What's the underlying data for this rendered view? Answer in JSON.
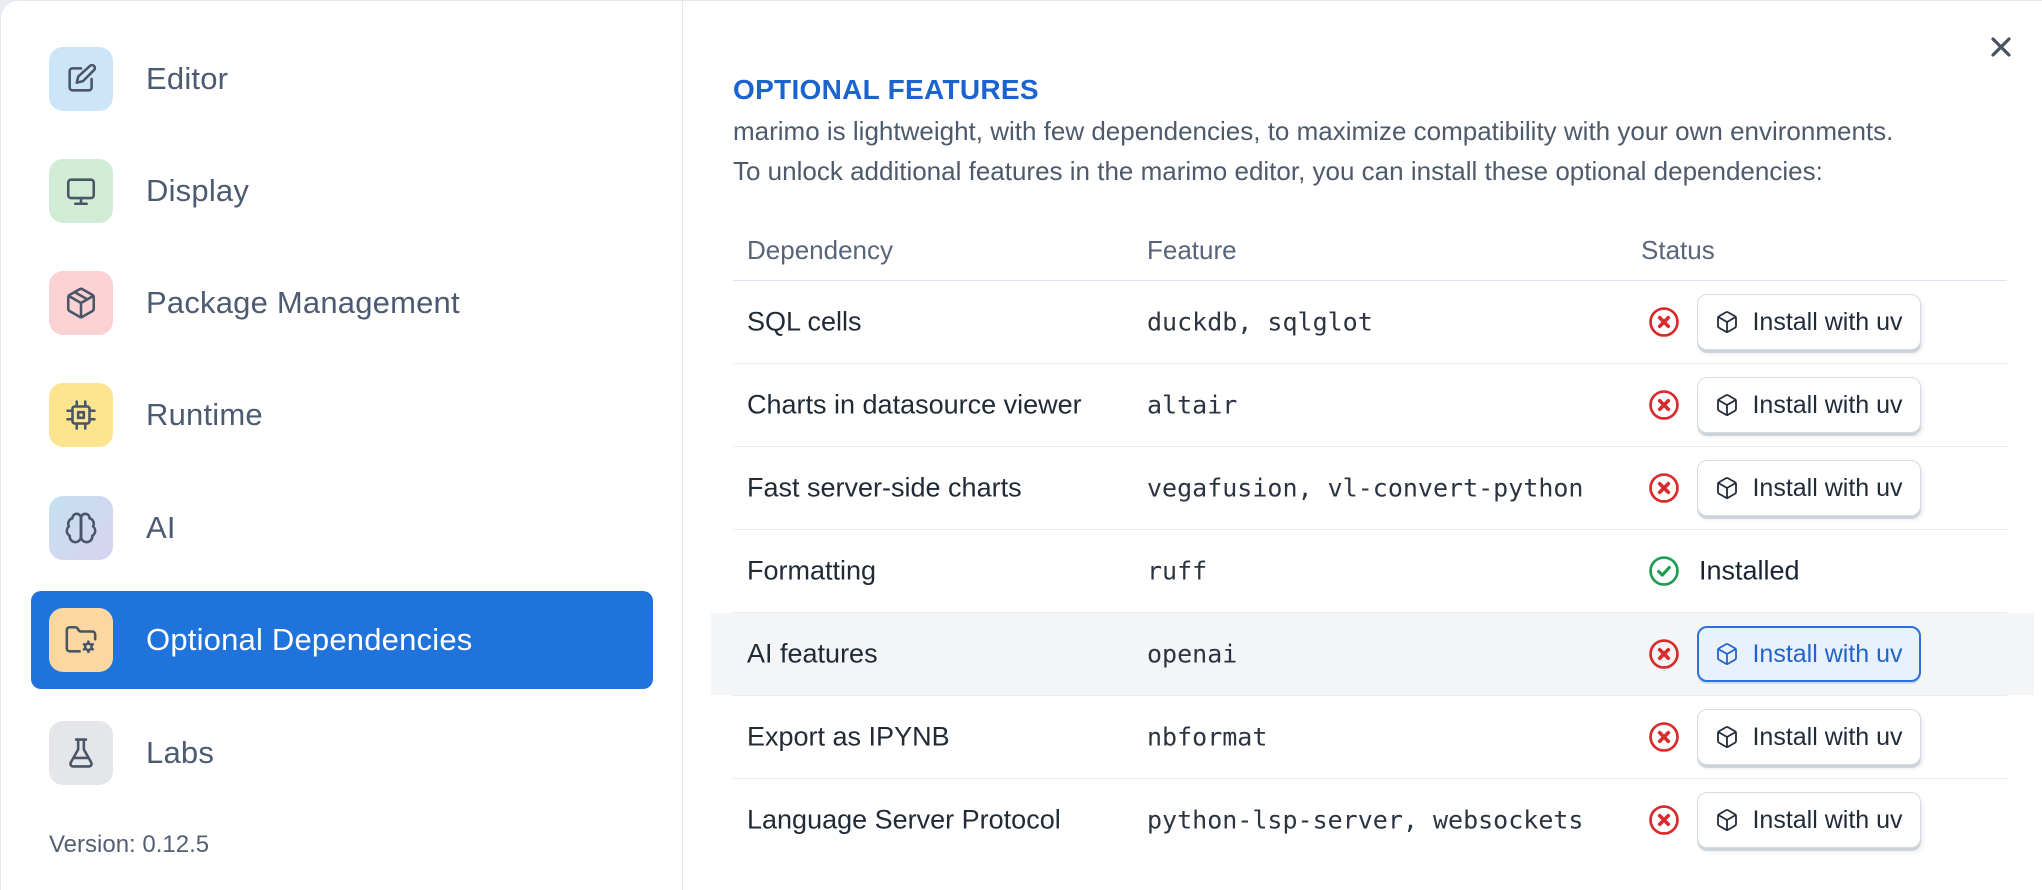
{
  "sidebar": {
    "items": [
      {
        "label": "Editor",
        "icon": "pencil-square-icon"
      },
      {
        "label": "Display",
        "icon": "monitor-icon"
      },
      {
        "label": "Package Management",
        "icon": "package-icon"
      },
      {
        "label": "Runtime",
        "icon": "cpu-icon"
      },
      {
        "label": "AI",
        "icon": "brain-icon"
      },
      {
        "label": "Optional Dependencies",
        "icon": "folder-cog-icon",
        "selected": true
      },
      {
        "label": "Labs",
        "icon": "flask-icon"
      }
    ],
    "version_label": "Version: 0.12.5"
  },
  "panel": {
    "title": "OPTIONAL FEATURES",
    "description_line1": "marimo is lightweight, with few dependencies, to maximize compatibility with your own environments.",
    "description_line2": "To unlock additional features in the marimo editor, you can install these optional dependencies:",
    "close_icon": "close-icon"
  },
  "table": {
    "columns": [
      "Dependency",
      "Feature",
      "Status"
    ],
    "rows": [
      {
        "dependency": "SQL cells",
        "feature": "duckdb, sqlglot",
        "status": "missing",
        "action": "Install with uv"
      },
      {
        "dependency": "Charts in datasource viewer",
        "feature": "altair",
        "status": "missing",
        "action": "Install with uv"
      },
      {
        "dependency": "Fast server-side charts",
        "feature": "vegafusion, vl-convert-python",
        "status": "missing",
        "action": "Install with uv"
      },
      {
        "dependency": "Formatting",
        "feature": "ruff",
        "status": "installed",
        "status_label": "Installed"
      },
      {
        "dependency": "AI features",
        "feature": "openai",
        "status": "missing",
        "action": "Install with uv",
        "highlighted": true
      },
      {
        "dependency": "Export as IPYNB",
        "feature": "nbformat",
        "status": "missing",
        "action": "Install with uv"
      },
      {
        "dependency": "Language Server Protocol",
        "feature": "python-lsp-server, websockets",
        "status": "missing",
        "action": "Install with uv"
      }
    ]
  },
  "colors": {
    "selected_item_bg": "#2173dc",
    "panel_title": "#1b63cf",
    "status_missing": "#d92b2b",
    "status_installed": "#1e9e4e",
    "highlighted_button_border": "#2b72d8",
    "highlighted_button_bg": "#e9f1fd",
    "tile_editor": "#cde5f8",
    "tile_display": "#d0ecd4",
    "tile_package": "#fbd2d3",
    "tile_runtime": "#fde48f",
    "tile_optional": "#fbd8a2",
    "tile_labs": "#e4e6ea"
  }
}
